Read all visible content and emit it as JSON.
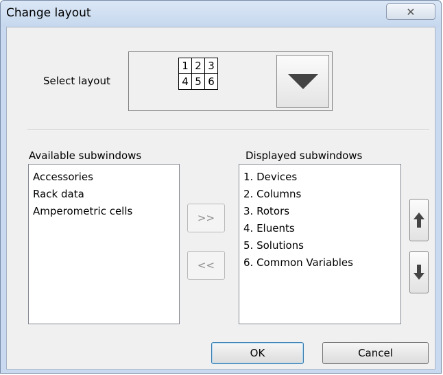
{
  "window": {
    "title": "Change layout",
    "close_glyph": "✕",
    "close_icon": "close-icon"
  },
  "layout_selector": {
    "label": "Select layout",
    "grid": [
      [
        "1",
        "2",
        "3"
      ],
      [
        "4",
        "5",
        "6"
      ]
    ],
    "dropdown_icon": "triangle-down-icon"
  },
  "available": {
    "label": "Available subwindows",
    "items": [
      "Accessories",
      "Rack data",
      "Amperometric cells"
    ]
  },
  "transfer": {
    "add_label": ">>",
    "remove_label": "<<"
  },
  "displayed": {
    "label": "Displayed subwindows",
    "items": [
      "1. Devices",
      "2. Columns",
      "3. Rotors",
      "4. Eluents",
      "5. Solutions",
      "6. Common Variables"
    ]
  },
  "order": {
    "up_icon": "arrow-up-icon",
    "down_icon": "arrow-down-icon"
  },
  "buttons": {
    "ok": "OK",
    "cancel": "Cancel"
  },
  "colors": {
    "titlebar": "#c6d8ee",
    "client": "#f0f0f0",
    "arrow": "#444444"
  }
}
